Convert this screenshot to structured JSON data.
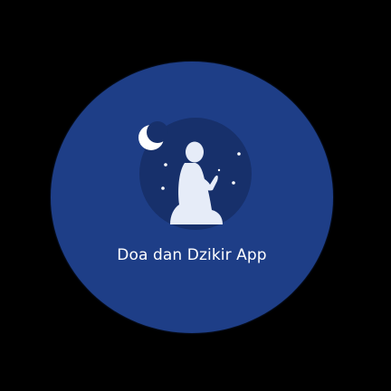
{
  "app": {
    "title": "Doa dan Dzikir App"
  },
  "icons": {
    "emblem": "praying-person-night-icon",
    "moon": "crescent-moon-icon",
    "stars": "star-icon"
  },
  "colors": {
    "background": "#000000",
    "badge": "#1E3E87",
    "inner_circle": "#17306B",
    "figure": "#E6ECF8",
    "text": "#FFFFFF"
  }
}
